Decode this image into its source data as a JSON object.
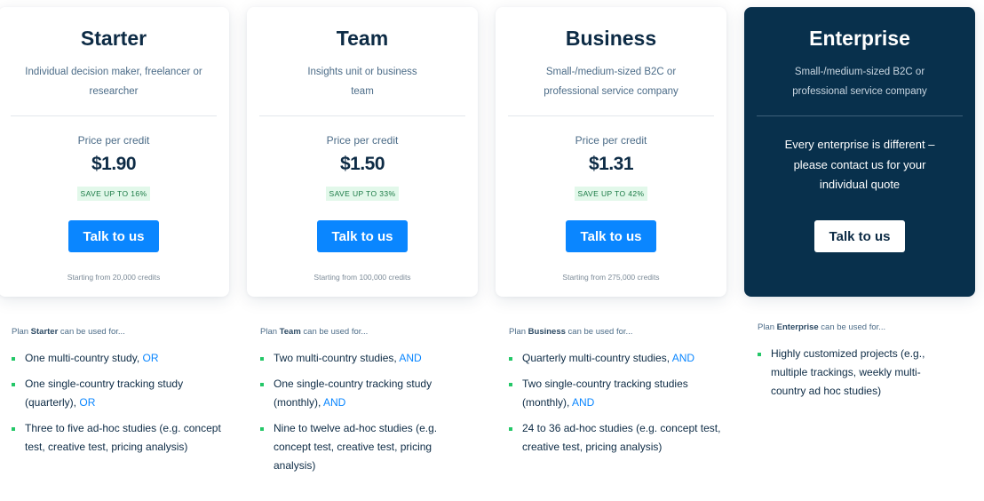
{
  "colors": {
    "primary": "#0a86ff",
    "dark_navy": "#08304c",
    "text": "#0d2b45",
    "badge_bg": "#e2f8ea",
    "badge_text": "#1a7a45",
    "bullet": "#24c768"
  },
  "plans": [
    {
      "name": "Starter",
      "subtitle": "Individual decision maker, freelancer or researcher",
      "price_label": "Price per credit",
      "price": "$1.90",
      "badge": "SAVE UP TO 16%",
      "cta": "Talk to us",
      "starting": "Starting from 20,000 credits",
      "usage_prefix": "Plan",
      "usage_suffix": "can be used for...",
      "usage": [
        {
          "text": "One multi-country study,",
          "conj": "OR"
        },
        {
          "text": "One single-country tracking study (quarterly),",
          "conj": "OR"
        },
        {
          "text": "Three to five ad-hoc studies (e.g. concept test, creative test, pricing analysis)",
          "conj": ""
        }
      ]
    },
    {
      "name": "Team",
      "subtitle": "Insights unit or business team",
      "price_label": "Price per credit",
      "price": "$1.50",
      "badge": "SAVE UP TO 33%",
      "cta": "Talk to us",
      "starting": "Starting from 100,000 credits",
      "usage_prefix": "Plan",
      "usage_suffix": "can be used for...",
      "usage": [
        {
          "text": "Two multi-country studies,",
          "conj": "AND"
        },
        {
          "text": "One single-country tracking study (monthly),",
          "conj": "AND"
        },
        {
          "text": "Nine to twelve ad-hoc studies (e.g. concept test, creative test, pricing analysis)",
          "conj": ""
        }
      ]
    },
    {
      "name": "Business",
      "subtitle": "Small-/medium-sized B2C or professional service company",
      "price_label": "Price per credit",
      "price": "$1.31",
      "badge": "SAVE UP TO 42%",
      "cta": "Talk to us",
      "starting": "Starting from 275,000 credits",
      "usage_prefix": "Plan",
      "usage_suffix": "can be used for...",
      "usage": [
        {
          "text": "Quarterly multi-country studies,",
          "conj": "AND"
        },
        {
          "text": "Two single-country tracking studies (monthly),",
          "conj": "AND"
        },
        {
          "text": "24 to 36 ad-hoc studies (e.g. concept test, creative test, pricing analysis)",
          "conj": ""
        }
      ]
    },
    {
      "name": "Enterprise",
      "subtitle": "Small-/medium-sized B2C or professional service company",
      "message": "Every enterprise is different – please contact us for your individual quote",
      "cta": "Talk to us",
      "usage_prefix": "Plan",
      "usage_suffix": "can be used for...",
      "usage": [
        {
          "text": "Highly customized projects (e.g., multiple trackings, weekly multi-country ad hoc studies)",
          "conj": ""
        }
      ]
    }
  ]
}
